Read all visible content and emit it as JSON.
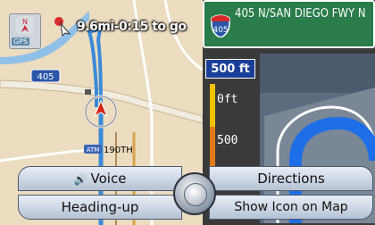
{
  "status": {
    "eta_text": "9.6mi-0:15 to go",
    "gps_label": "GPS",
    "highway_number": "405"
  },
  "map": {
    "poi_label": "190TH",
    "atm_label": "ATM",
    "colors": {
      "land": "#ecdcc0",
      "road": "#ffffff",
      "freeway": "#e8a83a",
      "water": "#8fc0e8",
      "route": "#3a8ad8"
    }
  },
  "guidance": {
    "sign_highway": "405",
    "sign_text": "405 N/SAN DIEGO FWY N",
    "distance": "500 ft",
    "meter_label_0": "0ft",
    "meter_label_500": "500",
    "colors": {
      "sign_bg": "#2a7c4a",
      "distance_bg": "#1a3f98",
      "route_arrow": "#1e6ee8"
    }
  },
  "menu": {
    "voice": "Voice",
    "directions": "Directions",
    "heading": "Heading-up",
    "show_icon": "Show Icon on Map"
  }
}
